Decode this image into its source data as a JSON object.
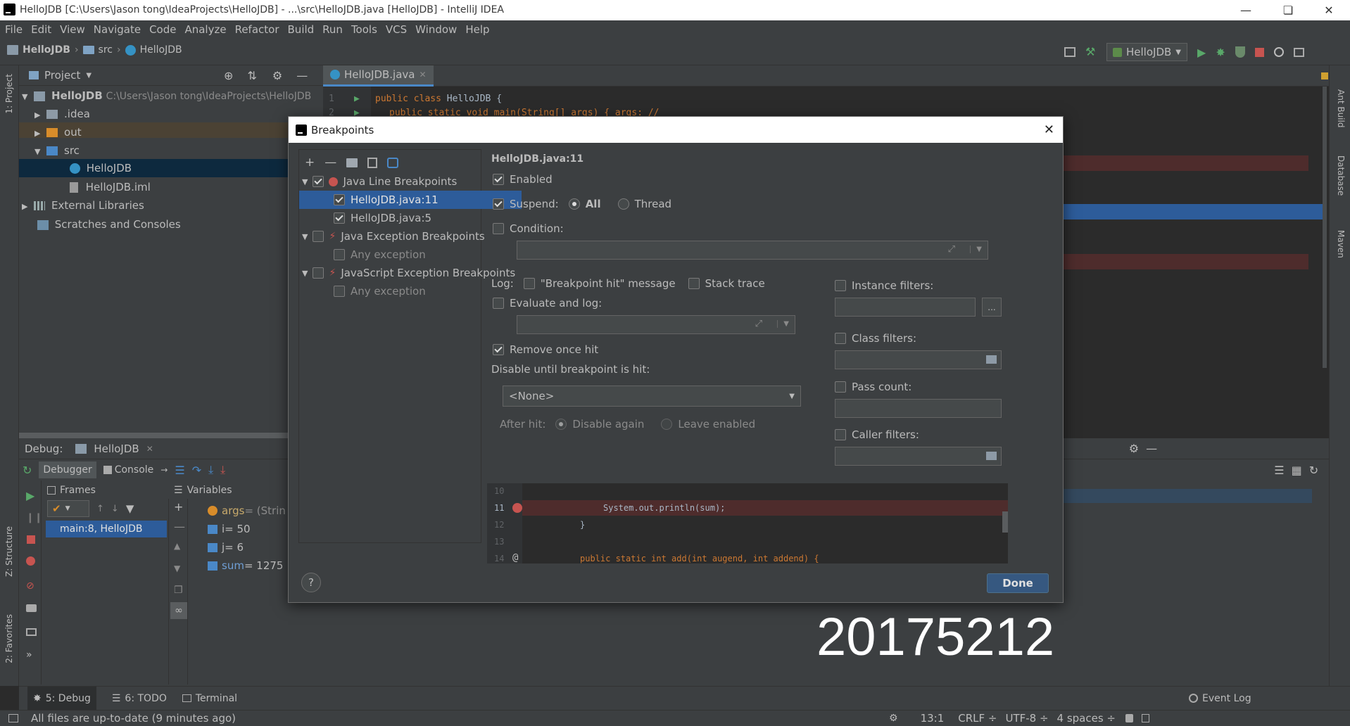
{
  "window": {
    "title": "HelloJDB [C:\\Users\\Jason tong\\IdeaProjects\\HelloJDB] - ...\\src\\HelloJDB.java [HelloJDB] - IntelliJ IDEA"
  },
  "menu": [
    "File",
    "Edit",
    "View",
    "Navigate",
    "Code",
    "Analyze",
    "Refactor",
    "Build",
    "Run",
    "Tools",
    "VCS",
    "Window",
    "Help"
  ],
  "breadcrumb": {
    "project": "HelloJDB",
    "folder": "src",
    "file": "HelloJDB"
  },
  "toolbar": {
    "run_config": "HelloJDB"
  },
  "side_left": {
    "project": "1: Project",
    "structure": "Z: Structure",
    "favorites": "2: Favorites"
  },
  "side_right": {
    "ant": "Ant Build",
    "database": "Database",
    "maven": "Maven"
  },
  "project_panel": {
    "title": "Project",
    "root": {
      "name": "HelloJDB",
      "path": "C:\\Users\\Jason tong\\IdeaProjects\\HelloJDB"
    },
    "items": [
      ".idea",
      "out",
      "src",
      "HelloJDB",
      "HelloJDB.iml",
      "External Libraries",
      "Scratches and Consoles"
    ]
  },
  "editor": {
    "tab": "HelloJDB.java",
    "lines": [
      {
        "num": "1",
        "kw": "public class",
        "text": " HelloJDB {"
      },
      {
        "num": "2",
        "text": "public static void main(String[] args) {  args: //"
      }
    ]
  },
  "debug_panel": {
    "label": "Debug:",
    "session": "HelloJDB",
    "tabs": [
      "Debugger",
      "Console"
    ],
    "frames_label": "Frames",
    "variables_label": "Variables",
    "frame": "main:8, HelloJDB",
    "variables": [
      {
        "name": "args",
        "value": " = (Strin"
      },
      {
        "name": "i",
        "value": " = 50"
      },
      {
        "name": "j",
        "value": " = 6"
      },
      {
        "name": "sum",
        "value": " = 1275"
      }
    ]
  },
  "bottom_tabs": {
    "debug": "5: Debug",
    "todo": "6: TODO",
    "terminal": "Terminal",
    "event_log": "Event Log"
  },
  "status": {
    "message": "All files are up-to-date (9 minutes ago)",
    "position": "13:1",
    "line_sep": "CRLF ÷",
    "encoding": "UTF-8 ÷",
    "indent": "4 spaces ÷"
  },
  "watermark": "20175212",
  "dialog": {
    "title": "Breakpoints",
    "tree": [
      {
        "label": "Java Line Breakpoints",
        "level": 0
      },
      {
        "label": "HelloJDB.java:11",
        "level": 1
      },
      {
        "label": "HelloJDB.java:5",
        "level": 1
      },
      {
        "label": "Java Exception Breakpoints",
        "level": 0
      },
      {
        "label": "Any exception",
        "level": 1
      },
      {
        "label": "JavaScript Exception Breakpoints",
        "level": 0
      },
      {
        "label": "Any exception",
        "level": 1
      }
    ],
    "heading": "HelloJDB.java:11",
    "enabled": "Enabled",
    "suspend": "Suspend:",
    "all": "All",
    "thread": "Thread",
    "condition": "Condition:",
    "log": "Log:",
    "log_message": "\"Breakpoint hit\" message",
    "stack_trace": "Stack trace",
    "evaluate": "Evaluate and log:",
    "remove_once": "Remove once hit",
    "disable_until": "Disable until breakpoint is hit:",
    "none_option": "<None>",
    "after_hit": "After hit:",
    "disable_again": "Disable again",
    "leave_enabled": "Leave enabled",
    "instance_filters": "Instance filters:",
    "class_filters": "Class filters:",
    "pass_count": "Pass count:",
    "caller_filters": "Caller filters:",
    "dots": "...",
    "help": "?",
    "done": "Done",
    "preview": [
      {
        "num": "10",
        "code": ""
      },
      {
        "num": "11",
        "code": "System.out.println(sum);"
      },
      {
        "num": "12",
        "code": "}"
      },
      {
        "num": "13",
        "code": ""
      },
      {
        "num": "14",
        "code": "public static int add(int augend, int addend) {"
      }
    ]
  }
}
